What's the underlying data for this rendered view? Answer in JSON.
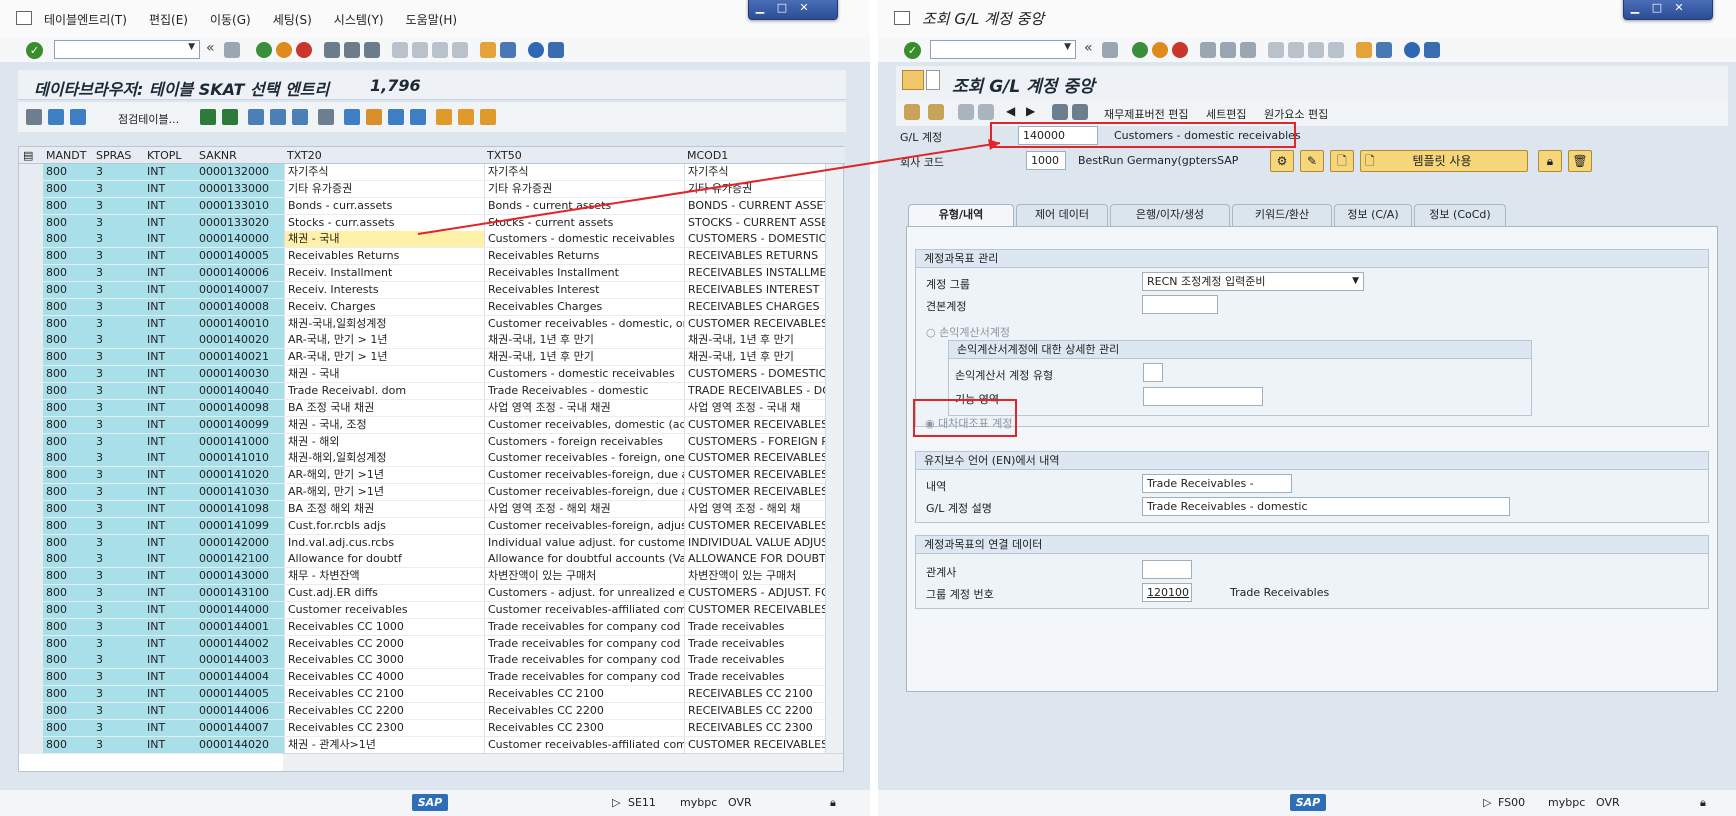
{
  "left": {
    "menu": [
      "테이블엔트리(T)",
      "편집(E)",
      "이동(G)",
      "세팅(S)",
      "시스템(Y)",
      "도움말(H)"
    ],
    "title": "데이타브라우저: 테이블 SKAT 선택 엔트리",
    "count": "1,796",
    "toolbar_label": "점검테이블...",
    "columns": [
      "MANDT",
      "SPRAS",
      "KTOPL",
      "SAKNR",
      "TXT20",
      "TXT50",
      "MCOD1"
    ],
    "rows": [
      [
        "800",
        "3",
        "INT",
        "0000132000",
        "자기주식",
        "자기주식",
        "자기주식"
      ],
      [
        "800",
        "3",
        "INT",
        "0000133000",
        "기타 유가증권",
        "기타 유가증권",
        "기타 유가증권"
      ],
      [
        "800",
        "3",
        "INT",
        "0000133010",
        "Bonds - curr.assets",
        "Bonds - current assets",
        "BONDS - CURRENT ASSETS"
      ],
      [
        "800",
        "3",
        "INT",
        "0000133020",
        "Stocks - curr.assets",
        "Stocks - current assets",
        "STOCKS - CURRENT ASSETS"
      ],
      [
        "800",
        "3",
        "INT",
        "0000140000",
        "채권 - 국내",
        "Customers - domestic receivables",
        "CUSTOMERS - DOMESTIC RE"
      ],
      [
        "800",
        "3",
        "INT",
        "0000140005",
        "Receivables Returns",
        "Receivables Returns",
        "RECEIVABLES RETURNS"
      ],
      [
        "800",
        "3",
        "INT",
        "0000140006",
        "Receiv. Installment",
        "Receivables Installment",
        "RECEIVABLES INSTALLMENT"
      ],
      [
        "800",
        "3",
        "INT",
        "0000140007",
        "Receiv. Interests",
        "Receivables Interest",
        "RECEIVABLES INTEREST"
      ],
      [
        "800",
        "3",
        "INT",
        "0000140008",
        "Receiv. Charges",
        "Receivables Charges",
        "RECEIVABLES CHARGES"
      ],
      [
        "800",
        "3",
        "INT",
        "0000140010",
        "채권-국내,일회성계정",
        "Customer receivables - domestic, on",
        "CUSTOMER RECEIVABLES - D"
      ],
      [
        "800",
        "3",
        "INT",
        "0000140020",
        "AR-국내, 만기 > 1년",
        "채권-국내, 1년 후 만기",
        "채권-국내, 1년 후 만기"
      ],
      [
        "800",
        "3",
        "INT",
        "0000140021",
        "AR-국내, 만기 > 1년",
        "채권-국내, 1년 후 만기",
        "채권-국내, 1년 후 만기"
      ],
      [
        "800",
        "3",
        "INT",
        "0000140030",
        "채권 - 국내",
        "Customers - domestic receivables",
        "CUSTOMERS - DOMESTIC RE"
      ],
      [
        "800",
        "3",
        "INT",
        "0000140040",
        "Trade Receivabl. dom",
        "Trade Receivables - domestic",
        "TRADE RECEIVABLES - DOMI"
      ],
      [
        "800",
        "3",
        "INT",
        "0000140098",
        "BA 조정 국내 채권",
        "사업 영역 조정 - 국내 채권",
        "사업 영역 조정 - 국내 채"
      ],
      [
        "800",
        "3",
        "INT",
        "0000140099",
        "채권 - 국내, 조정",
        "Customer receivables, domestic (adj",
        "CUSTOMER RECEIVABLES, D"
      ],
      [
        "800",
        "3",
        "INT",
        "0000141000",
        "채권 - 해외",
        "Customers - foreign receivables",
        "CUSTOMERS - FOREIGN REC"
      ],
      [
        "800",
        "3",
        "INT",
        "0000141010",
        "채권-해외,일회성계정",
        "Customer receivables - foreign, one-",
        "CUSTOMER RECEIVABLES - F"
      ],
      [
        "800",
        "3",
        "INT",
        "0000141020",
        "AR-해외, 만기 >1년",
        "Customer receivables-foreign, due a",
        "CUSTOMER RECEIVABLES-FO"
      ],
      [
        "800",
        "3",
        "INT",
        "0000141030",
        "AR-해외, 만기 >1년",
        "Customer receivables-foreign, due a",
        "CUSTOMER RECEIVABLES-FO"
      ],
      [
        "800",
        "3",
        "INT",
        "0000141098",
        "BA 조정 해외 채권",
        "사업 영역 조정 - 해외 채권",
        "사업 영역 조정 - 해외 채"
      ],
      [
        "800",
        "3",
        "INT",
        "0000141099",
        "Cust.for.rcbls adjs",
        "Customer receivables-foreign, adjust",
        "CUSTOMER RECEIVABLES-FO"
      ],
      [
        "800",
        "3",
        "INT",
        "0000142000",
        "Ind.val.adj.cus.rcbs",
        "Individual value adjust. for customer",
        "INDIVIDUAL VALUE ADJUST"
      ],
      [
        "800",
        "3",
        "INT",
        "0000142100",
        "Allowance for doubtf",
        "Allowance for doubtful accounts (Val",
        "ALLOWANCE FOR DOUBTFU"
      ],
      [
        "800",
        "3",
        "INT",
        "0000143000",
        "채무 - 차변잔액",
        "차변잔액이 있는 구매처",
        "차변잔액이 있는 구매처"
      ],
      [
        "800",
        "3",
        "INT",
        "0000143100",
        "Cust.adj.ER diffs",
        "Customers - adjust. for unrealized e",
        "CUSTOMERS - ADJUST. FOR"
      ],
      [
        "800",
        "3",
        "INT",
        "0000144000",
        "Customer receivables",
        "Customer receivables-affiliated comp",
        "CUSTOMER RECEIVABLES-AF"
      ],
      [
        "800",
        "3",
        "INT",
        "0000144001",
        "Receivables CC 1000",
        "Trade receivables for company cod",
        "Trade receivables"
      ],
      [
        "800",
        "3",
        "INT",
        "0000144002",
        "Receivables CC 2000",
        "Trade receivables for company cod",
        "Trade receivables"
      ],
      [
        "800",
        "3",
        "INT",
        "0000144003",
        "Receivables CC 3000",
        "Trade receivables for company cod",
        "Trade receivables"
      ],
      [
        "800",
        "3",
        "INT",
        "0000144004",
        "Receivables CC 4000",
        "Trade receivables for company cod",
        "Trade receivables"
      ],
      [
        "800",
        "3",
        "INT",
        "0000144005",
        "Receivables CC 2100",
        "Receivables CC 2100",
        "RECEIVABLES CC 2100"
      ],
      [
        "800",
        "3",
        "INT",
        "0000144006",
        "Receivables CC 2200",
        "Receivables CC 2200",
        "RECEIVABLES CC 2200"
      ],
      [
        "800",
        "3",
        "INT",
        "0000144007",
        "Receivables CC 2300",
        "Receivables CC 2300",
        "RECEIVABLES CC 2300"
      ],
      [
        "800",
        "3",
        "INT",
        "0000144020",
        "채권 - 관계사>1년",
        "Customer receivables-affiliated comp",
        "CUSTOMER RECEIVABLES-AF"
      ]
    ],
    "status": {
      "tcode": "SE11",
      "server": "mybpc",
      "mode": "OVR"
    }
  },
  "right": {
    "window_title": "조회 G/L 계정 중앙",
    "title": "조회 G/L 계정 중앙",
    "toolbar": [
      "재무제표버전 편집",
      "세트편집",
      "원가요소 편집"
    ],
    "gl_label": "G/L 계정",
    "gl_value": "140000",
    "gl_desc": "Customers - domestic receivables",
    "cc_label": "회사 코드",
    "cc_value": "1000",
    "cc_desc": "BestRun Germany(gptersSAP",
    "template_btn": "템플릿 사용",
    "tabs": [
      "유형/내역",
      "제어 데이터",
      "은행/이자/생성",
      "키워드/환산",
      "정보 (C/A)",
      "정보 (CoCd)"
    ],
    "coa_group": {
      "header": "계정과목표 관리",
      "acct_group_label": "계정 그룹",
      "acct_group_value": "RECN 조정계정 입력준비",
      "sample_label": "견본계정",
      "pl_radio": "손익계산서계정",
      "pl_detail_header": "손익계산서계정에 대한 상세한 관리",
      "pl_type_label": "손익계산서 계정 유형",
      "func_area_label": "기능 영역",
      "bs_radio": "대차대조표 계정"
    },
    "desc_group": {
      "header": "유지보수 언어 (EN)에서 내역",
      "short_label": "내역",
      "short_value": "Trade Receivables -",
      "long_label": "G/L 계정 설명",
      "long_value": "Trade Receivables - domestic"
    },
    "consol_group": {
      "header": "계정과목표의 연결 데이터",
      "partner_label": "관계사",
      "group_acct_label": "그룹 계정 번호",
      "group_acct_value": "120100",
      "group_acct_desc": "Trade Receivables"
    },
    "status": {
      "tcode": "FS00",
      "server": "mybpc",
      "mode": "OVR"
    }
  },
  "colors": {
    "key_col": "#a8dfe9",
    "highlight": "#fff1a8",
    "annotation": "#e0262a"
  }
}
